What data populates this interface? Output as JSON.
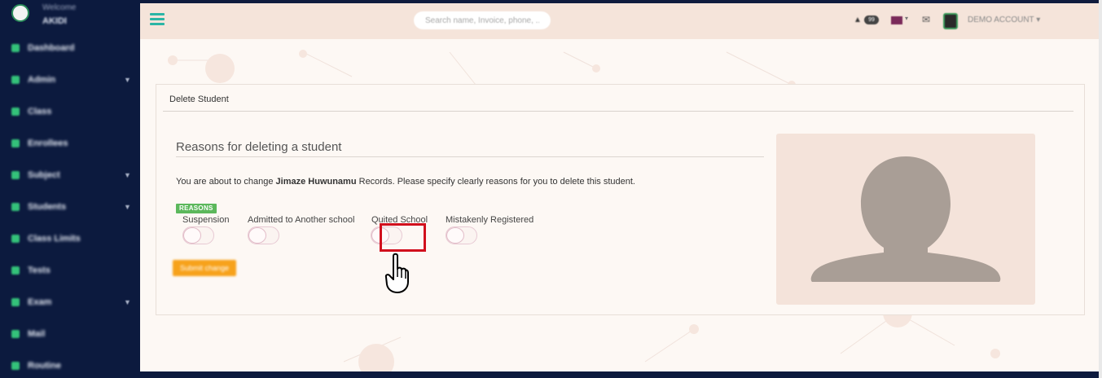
{
  "sidebar": {
    "welcome": "Welcome",
    "user": "AKIDI",
    "items": [
      {
        "label": "Dashboard",
        "chevron": false
      },
      {
        "label": "Admin",
        "chevron": true
      },
      {
        "label": "Class",
        "chevron": false
      },
      {
        "label": "Enrollees",
        "chevron": false
      },
      {
        "label": "Subject",
        "chevron": true
      },
      {
        "label": "Students",
        "chevron": true
      },
      {
        "label": "Class Limits",
        "chevron": false
      },
      {
        "label": "Tests",
        "chevron": false
      },
      {
        "label": "Exam",
        "chevron": true
      },
      {
        "label": "Mail",
        "chevron": false
      },
      {
        "label": "Routine",
        "chevron": false
      }
    ]
  },
  "topbar": {
    "search_placeholder": "Search name, Invoice, phone, ...",
    "notification_count": "99",
    "account_label": "DEMO ACCOUNT"
  },
  "card": {
    "header": "Delete Student",
    "section_title": "Reasons for deleting a student",
    "desc_prefix": "You are about to change ",
    "student_name": "Jimaze Huwunamu",
    "desc_suffix": " Records. Please specify clearly reasons for you to delete this student.",
    "reasons_badge": "REASONS",
    "options": [
      "Suspension",
      "Admitted to Another school",
      "Quited School",
      "Mistakenly Registered"
    ],
    "submit_label": "Submit change"
  },
  "colors": {
    "sidebar_bg": "#0c1a3e",
    "accent_teal": "#2bb5a5",
    "badge_green": "#5cb85c",
    "submit_orange": "#f7a21b",
    "highlight_red": "#d10f1c",
    "avatar_gray": "#a99e96"
  },
  "icons": {
    "menu": "hamburger-icon",
    "notifications": "bell-icon",
    "language": "flag-icon",
    "mail": "mail-icon",
    "pointer": "pointing-hand-icon",
    "avatar": "user-silhouette-icon"
  }
}
